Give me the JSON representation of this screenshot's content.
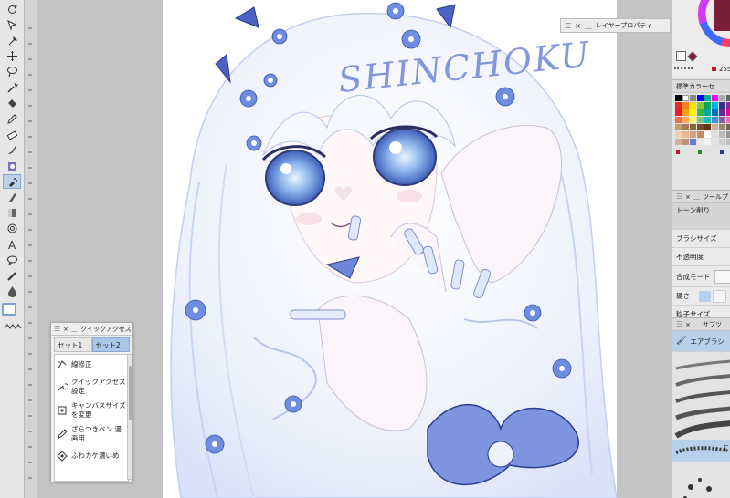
{
  "left_toolbar": {
    "tools": [
      {
        "name": "rotate-icon"
      },
      {
        "name": "object-select-icon"
      },
      {
        "name": "eyedropper-icon"
      },
      {
        "name": "move-icon"
      },
      {
        "name": "lasso-icon"
      },
      {
        "name": "magic-wand-icon"
      },
      {
        "name": "fill-icon"
      },
      {
        "name": "pen-icon"
      },
      {
        "name": "eraser-icon"
      },
      {
        "name": "brush-icon"
      },
      {
        "name": "decoration-icon"
      },
      {
        "name": "airbrush-icon"
      },
      {
        "name": "blend-icon"
      },
      {
        "name": "gradient-icon"
      },
      {
        "name": "figure-icon"
      },
      {
        "name": "text-icon"
      },
      {
        "name": "balloon-icon"
      },
      {
        "name": "line-correction-icon"
      },
      {
        "name": "ink-drop-icon"
      }
    ]
  },
  "canvas": {
    "artwork_text": "SHINCHOKU"
  },
  "layer_property": {
    "title": "レイヤープロパティ"
  },
  "color_panel": {
    "value": "255"
  },
  "standard_colors": {
    "title": "標準カラーセ"
  },
  "tool_property": {
    "title": "ツールプ",
    "subtool": "トーン削り",
    "rows": [
      "ブラシサイズ",
      "不透明度",
      "合成モード",
      "硬さ",
      "粒子サイズ"
    ]
  },
  "sub_tool": {
    "title": "サブツ",
    "selected": "エアブラシ",
    "extra": "に"
  },
  "quick_access": {
    "title": "クイックアクセス",
    "tabs": [
      "セット1",
      "セット2"
    ],
    "items": [
      "線修正",
      "クイックアクセス設定",
      "キャンバスサイズを変更",
      "ざらつきペン 漫画用",
      "ふわカケ濃いめ"
    ]
  },
  "colors": {
    "selected_tab": "#a9c7ea",
    "tool_highlight": "#bcd0e8",
    "art_blue": "#5d78d8",
    "hue_ring_top": "#ff3b6b"
  }
}
